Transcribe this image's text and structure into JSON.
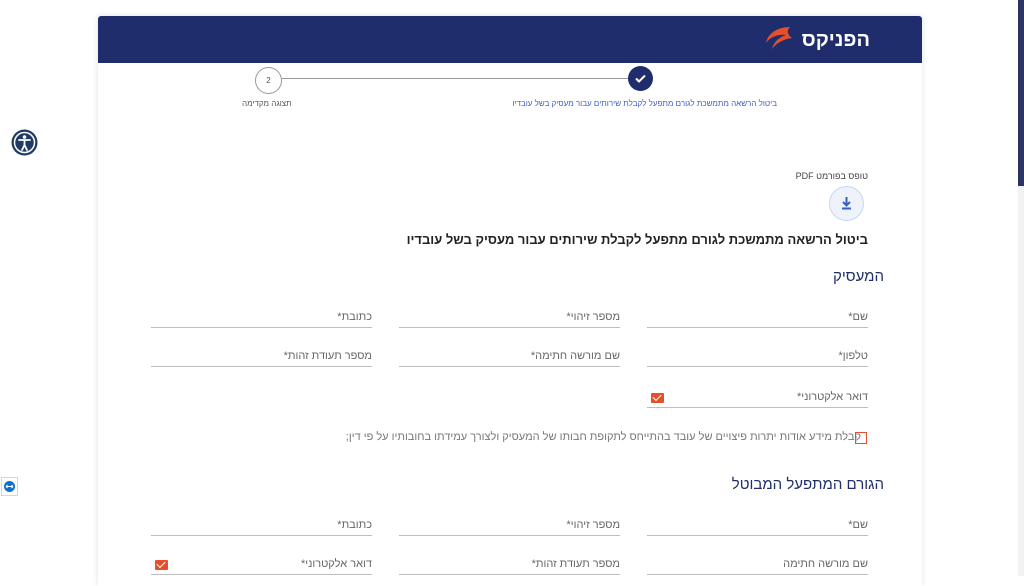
{
  "brand": {
    "name": "הפניקס"
  },
  "stepper": {
    "step1_label": "ביטול הרשאה מתמשכת לגורם מתפעל לקבלת שירותים עבור מעסיק בשל עובדיו",
    "step2_number": "2",
    "step2_label": "תצוגה מקדימה"
  },
  "pdf": {
    "label": "טופס בפורמט PDF"
  },
  "form_title": "ביטול הרשאה מתמשכת לגורם מתפעל לקבלת שירותים עבור מעסיק בשל עובדיו",
  "employer": {
    "title": "המעסיק",
    "name": "שם*",
    "id_number": "מספר זיהוי*",
    "address": "כתובת*",
    "phone": "טלפון*",
    "signatory": "שם מורשה חתימה*",
    "signatory_id": "מספר תעודת זהות*",
    "email": "דואר אלקטרוני*",
    "consent_text": "קבלת מידע אודות יתרות פיצויים של עובד בהתייחס לתקופת חבותו של המעסיק ולצורך עמידתו בחובותיו על פי דין;"
  },
  "operator": {
    "title": "הגורם המתפעל המבוטל",
    "name": "שם*",
    "id_number": "מספר זיהוי*",
    "address": "כתובת*",
    "signatory": "שם מורשה חתימה",
    "signatory_id": "מספר תעודת זהות*",
    "email": "דואר אלקטרוני*"
  },
  "colors": {
    "brand_navy": "#202d6c",
    "accent_orange": "#e5502b",
    "step_link": "#3b5fc4"
  },
  "icons": {
    "accessibility": "accessibility-icon",
    "download": "download-icon",
    "check": "check-icon",
    "mail": "mail-icon",
    "teamviewer": "teamviewer-icon"
  }
}
